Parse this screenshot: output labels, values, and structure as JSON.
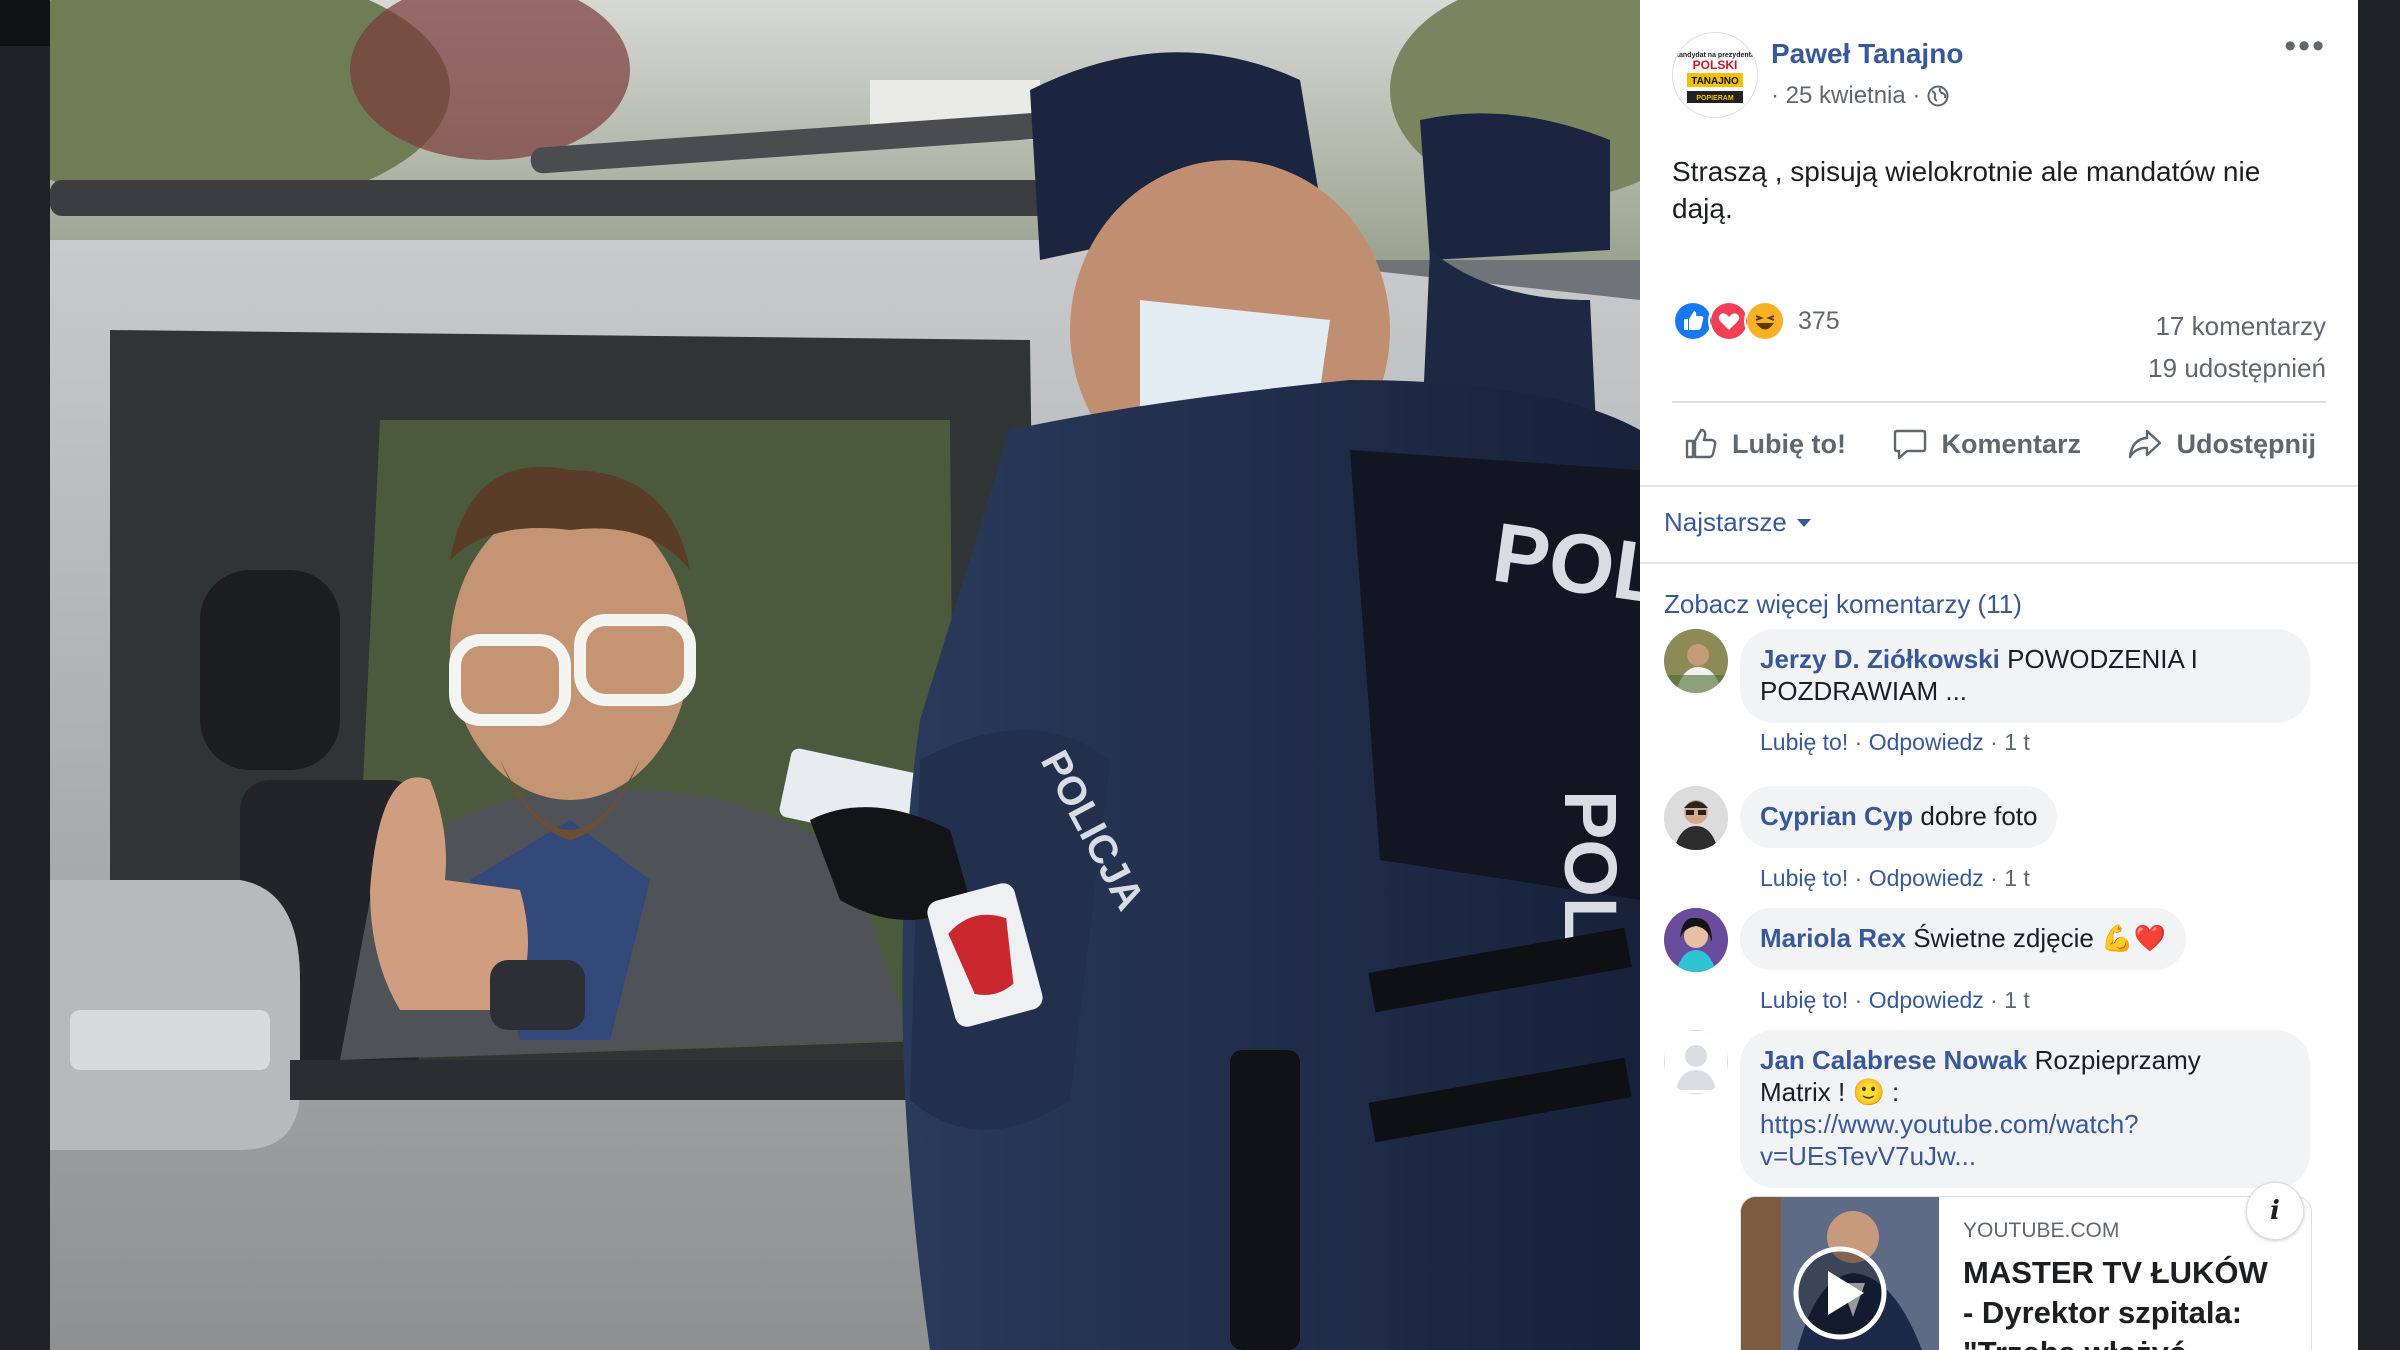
{
  "post": {
    "author": "Paweł Tanajno",
    "date": "· 25 kwietnia ·",
    "privacy_icon": "globe-icon",
    "more_label": "•••",
    "text": "Straszą , spisują wielokrotnie ale mandatów nie dają.",
    "reactions": {
      "icons": [
        "like-icon",
        "love-icon",
        "haha-icon"
      ],
      "count": "375"
    },
    "comments_count": "17 komentarzy",
    "shares_count": "19 udostępnień",
    "page_logo": {
      "line1": "kandydat na prezydenta",
      "line2": "POLSKI",
      "line3": "TANAJNO",
      "line4": "POPIERAM"
    }
  },
  "actions": {
    "like": "Lubię to!",
    "comment": "Komentarz",
    "share": "Udostępnij"
  },
  "comments_section": {
    "sort_label": "Najstarsze",
    "see_more": "Zobacz więcej komentarzy (11)",
    "comments": [
      {
        "name": "Jerzy D. Ziółkowski",
        "text": "POWODZENIA I",
        "text2": "POZDRAWIAM ...",
        "like": "Lubię to!",
        "reply": "Odpowiedz",
        "time": "1 t"
      },
      {
        "name": "Cyprian Cyp",
        "text": "dobre foto",
        "like": "Lubię to!",
        "reply": "Odpowiedz",
        "time": "1 t"
      },
      {
        "name": "Mariola Rex",
        "text": "Świetne zdjęcie 💪❤️",
        "like": "Lubię to!",
        "reply": "Odpowiedz",
        "time": "1 t"
      },
      {
        "name": "Jan Calabrese Nowak",
        "text": "Rozpieprzamy",
        "text2": "Matrix ! 🙂 :",
        "link1": "https://www.youtube.com/watch?",
        "link2": "v=UEsTevV7uJw..."
      }
    ]
  },
  "link_preview": {
    "source": "YOUTUBE.COM",
    "title_line1": "MASTER TV ŁUKÓW",
    "title_line2": "- Dyrektor szpitala:",
    "title_line3": "\"Trzeba włożyć",
    "info_label": "i"
  },
  "photo_text": {
    "vest_back": "POLI",
    "vest_side": "POL",
    "sleeve": "POLICJA"
  },
  "colors": {
    "link": "#385898",
    "muted": "#606770",
    "bubble": "#f2f3f5",
    "police_blue": "#1f2c44"
  }
}
